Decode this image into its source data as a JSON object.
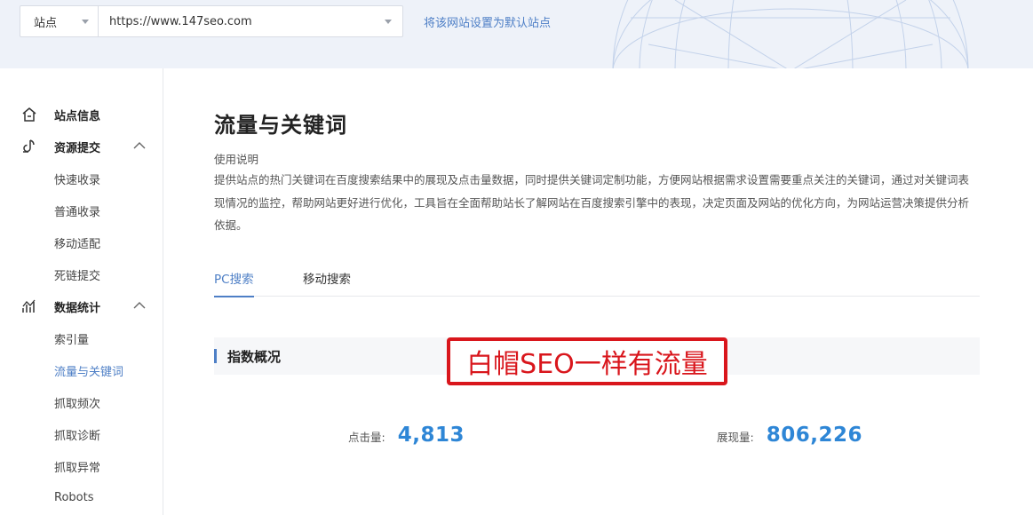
{
  "site_bar": {
    "type_label": "站点",
    "url_value": "https://www.147seo.com",
    "set_default_link": "将该网站设置为默认站点"
  },
  "sidebar": {
    "groups": [
      {
        "label": "站点信息",
        "icon": "home-icon"
      },
      {
        "label": "资源提交",
        "icon": "submit-icon",
        "items": [
          "快速收录",
          "普通收录",
          "移动适配",
          "死链提交"
        ]
      },
      {
        "label": "数据统计",
        "icon": "stats-icon",
        "items": [
          "索引量",
          "流量与关键词",
          "抓取频次",
          "抓取诊断",
          "抓取异常",
          "Robots"
        ]
      }
    ],
    "active_item": "流量与关键词"
  },
  "main": {
    "title": "流量与关键词",
    "usage_title": "使用说明",
    "usage_desc": "提供站点的热门关键词在百度搜索结果中的展现及点击量数据，同时提供关键词定制功能，方便网站根据需求设置需要重点关注的关键词，通过对关键词表现情况的监控，帮助网站更好进行优化，工具旨在全面帮助站长了解网站在百度搜索引擎中的表现，决定页面及网站的优化方向，为网站运营决策提供分析依据。",
    "tabs": [
      "PC搜索",
      "移动搜索"
    ],
    "active_tab": "PC搜索",
    "overview_title": "指数概况",
    "metrics": {
      "clicks_label": "点击量:",
      "clicks_value": "4,813",
      "impressions_label": "展现量:",
      "impressions_value": "806,226"
    }
  },
  "watermark": "白帽SEO一样有流量",
  "colors": {
    "accent": "#4e7fc6",
    "metric_value": "#2e86d6",
    "watermark_red": "#d9161c",
    "topbar_bg": "#eef2f9"
  }
}
